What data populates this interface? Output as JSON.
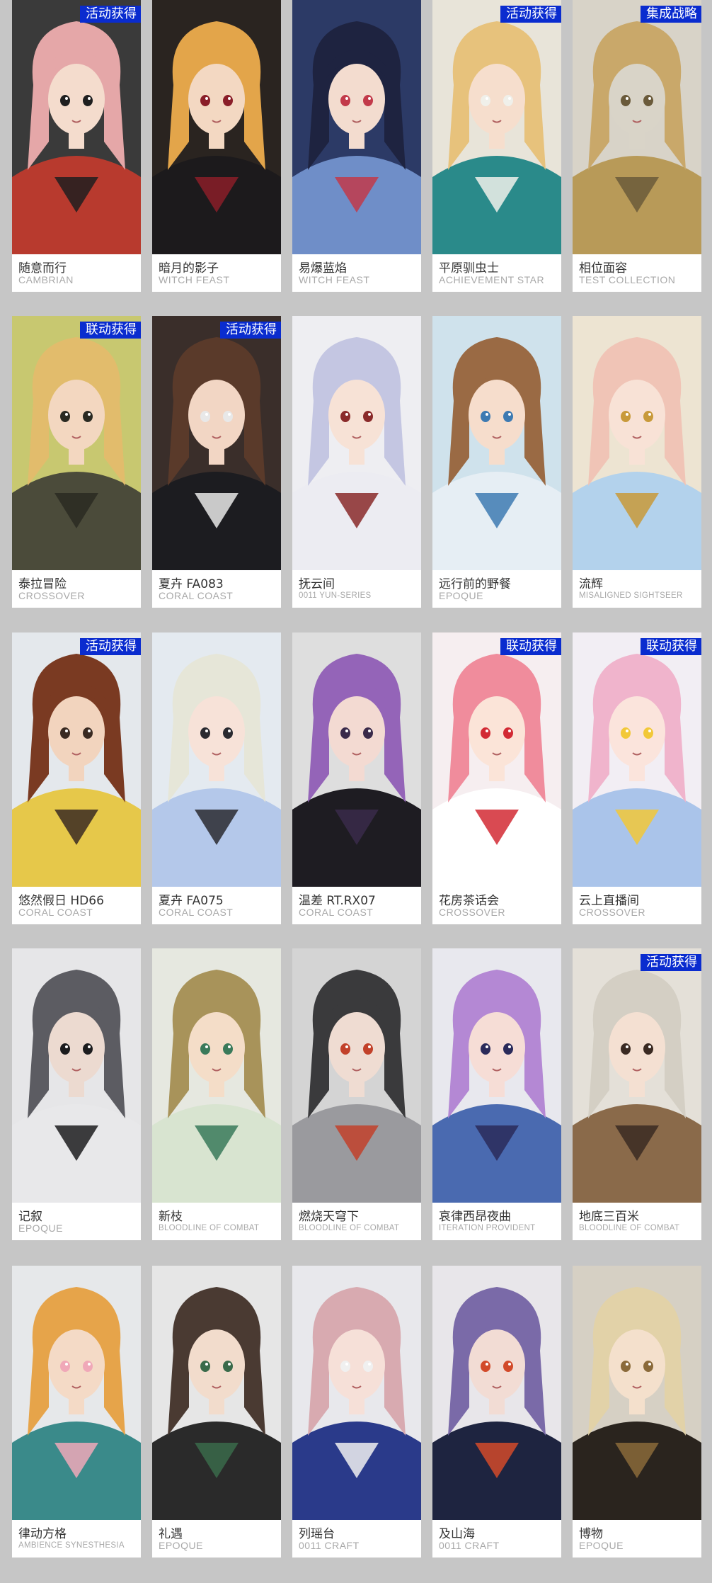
{
  "cards": [
    {
      "name": "随意而行",
      "series": "CAMBRIAN",
      "tag": "活动获得",
      "bg": "#3a3a3a",
      "hair": "#e5a7a8",
      "skin": "#f4dccd",
      "cloth": "#b83a2e",
      "accent": "#1f1f1f"
    },
    {
      "name": "暗月的影子",
      "series": "WITCH FEAST",
      "tag": "",
      "bg": "#2a2420",
      "hair": "#e3a54a",
      "skin": "#f3d8c2",
      "cloth": "#1c1a1c",
      "accent": "#8a1e28"
    },
    {
      "name": "易爆蓝焰",
      "series": "WITCH FEAST",
      "tag": "",
      "bg": "#2c3a66",
      "hair": "#1e2340",
      "skin": "#f3dccf",
      "cloth": "#6f8ec8",
      "accent": "#c23a4a"
    },
    {
      "name": "平原驯虫士",
      "series": "ACHIEVEMENT STAR",
      "tag": "活动获得",
      "bg": "#e8e4d9",
      "hair": "#e7c27c",
      "skin": "#f6decd",
      "cloth": "#2a8a8a",
      "accent": "#f0f0ea"
    },
    {
      "name": "相位面容",
      "series": "TEST COLLECTION",
      "tag": "集成战略",
      "bg": "#d8d3c8",
      "hair": "#c9a86a",
      "skin": "#d9d4c8",
      "cloth": "#b89a58",
      "accent": "#6a5a3a"
    },
    {
      "name": "泰拉冒险",
      "series": "CROSSOVER",
      "tag": "联动获得",
      "bg": "#c8c870",
      "hair": "#e2bc6c",
      "skin": "#f3d7c0",
      "cloth": "#4b4b3a",
      "accent": "#2a2a22"
    },
    {
      "name": "夏卉 FA083",
      "series": "CORAL COAST",
      "tag": "活动获得",
      "bg": "#3a2e2a",
      "hair": "#5a3a2a",
      "skin": "#f2d6c4",
      "cloth": "#1c1c20",
      "accent": "#e8e8e8"
    },
    {
      "name": "抚云间",
      "series": "0011 YUN-SERIES",
      "tag": "",
      "bg": "#eeeef2",
      "hair": "#c4c6e2",
      "skin": "#f7e2d6",
      "cloth": "#ececf2",
      "accent": "#8a2a2a"
    },
    {
      "name": "远行前的野餐",
      "series": "EPOQUE",
      "tag": "",
      "bg": "#cfe2ec",
      "hair": "#9a6a44",
      "skin": "#f6ddcc",
      "cloth": "#e6eef4",
      "accent": "#3d7ab2"
    },
    {
      "name": "流辉",
      "series": "MISALIGNED SIGHTSEER",
      "tag": "",
      "bg": "#ede4d2",
      "hair": "#f0c4b6",
      "skin": "#f8e2d6",
      "cloth": "#b3d2ec",
      "accent": "#c89a3a"
    },
    {
      "name": "悠然假日 HD66",
      "series": "CORAL COAST",
      "tag": "活动获得",
      "bg": "#e4e8ec",
      "hair": "#7a3a22",
      "skin": "#f2d4be",
      "cloth": "#e6c84a",
      "accent": "#3a2a22"
    },
    {
      "name": "夏卉 FA075",
      "series": "CORAL COAST",
      "tag": "",
      "bg": "#e4eaf0",
      "hair": "#e6e6d8",
      "skin": "#f7e2d8",
      "cloth": "#b4c8ea",
      "accent": "#2a2a30"
    },
    {
      "name": "温差 RT.RX07",
      "series": "CORAL COAST",
      "tag": "",
      "bg": "#dedede",
      "hair": "#9464b8",
      "skin": "#f3dad2",
      "cloth": "#1e1c22",
      "accent": "#3a2a4a"
    },
    {
      "name": "花房茶话会",
      "series": "CROSSOVER",
      "tag": "联动获得",
      "bg": "#f6eef0",
      "hair": "#f08c9c",
      "skin": "#fbe4d8",
      "cloth": "#ffffff",
      "accent": "#d22a34"
    },
    {
      "name": "云上直播间",
      "series": "CROSSOVER",
      "tag": "联动获得",
      "bg": "#f2eef4",
      "hair": "#f0b4cc",
      "skin": "#fbe4dc",
      "cloth": "#aac4ea",
      "accent": "#f2c838"
    },
    {
      "name": "记叙",
      "series": "EPOQUE",
      "tag": "",
      "bg": "#e6e6e8",
      "hair": "#5c5c62",
      "skin": "#ecdad0",
      "cloth": "#e8e8ea",
      "accent": "#1c1c1e"
    },
    {
      "name": "新枝",
      "series": "BLOODLINE OF COMBAT",
      "tag": "",
      "bg": "#e6e8e0",
      "hair": "#a8935a",
      "skin": "#f4ddc8",
      "cloth": "#d8e4d0",
      "accent": "#3a7a5a"
    },
    {
      "name": "燃烧天穹下",
      "series": "BLOODLINE OF COMBAT",
      "tag": "",
      "bg": "#d4d4d4",
      "hair": "#3a3a3c",
      "skin": "#efdcd2",
      "cloth": "#9a9a9e",
      "accent": "#c2412a"
    },
    {
      "name": "哀律西昂夜曲",
      "series": "ITERATION PROVIDENT",
      "tag": "",
      "bg": "#e8e8ee",
      "hair": "#b488d4",
      "skin": "#f6ddd6",
      "cloth": "#4a6ab0",
      "accent": "#2a2a5a"
    },
    {
      "name": "地底三百米",
      "series": "BLOODLINE OF COMBAT",
      "tag": "活动获得",
      "bg": "#e4e0d8",
      "hair": "#d4cfc4",
      "skin": "#f4e0d2",
      "cloth": "#8a6a4a",
      "accent": "#3a2a22"
    },
    {
      "name": "律动方格",
      "series": "AMBIENCE SYNESTHESIA",
      "tag": "",
      "bg": "#e6e8ea",
      "hair": "#e6a44a",
      "skin": "#f4dac6",
      "cloth": "#3a8a8a",
      "accent": "#f0a8b8"
    },
    {
      "name": "礼遇",
      "series": "EPOQUE",
      "tag": "",
      "bg": "#e6e6e6",
      "hair": "#4a3a32",
      "skin": "#f2dccc",
      "cloth": "#2a2a2a",
      "accent": "#3a6a4a"
    },
    {
      "name": "列瑶台",
      "series": "0011 CRAFT",
      "tag": "",
      "bg": "#e8e8ec",
      "hair": "#d8aab0",
      "skin": "#f6e0d8",
      "cloth": "#2a3a8a",
      "accent": "#f0f0f0"
    },
    {
      "name": "及山海",
      "series": "0011 CRAFT",
      "tag": "",
      "bg": "#e8e6ea",
      "hair": "#7a6aa8",
      "skin": "#f2dcd4",
      "cloth": "#1e2440",
      "accent": "#d24a2a"
    },
    {
      "name": "博物",
      "series": "EPOQUE",
      "tag": "",
      "bg": "#d6d0c4",
      "hair": "#e2d2a8",
      "skin": "#f4e0cc",
      "cloth": "#2a241e",
      "accent": "#8a6a3a"
    }
  ]
}
